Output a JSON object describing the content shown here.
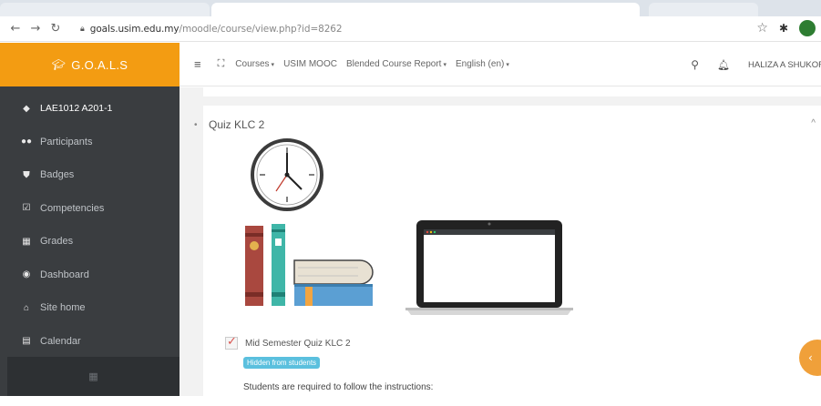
{
  "browser": {
    "url_host": "goals.usim.edu.my",
    "url_path": "/moodle/course/view.php?id=8262",
    "profile_initial": "",
    "colors": {
      "profile": "#2e7d32"
    }
  },
  "brand": {
    "label": "G.O.A.L.S",
    "color": "#f39c12",
    "icon": "graduation-cap-icon"
  },
  "sidebar": {
    "items": [
      {
        "label": "LAE1012 A201-1",
        "icon": "graduation-cap-icon"
      },
      {
        "label": "Participants",
        "icon": "users-icon"
      },
      {
        "label": "Badges",
        "icon": "shield-icon"
      },
      {
        "label": "Competencies",
        "icon": "checkbox-icon"
      },
      {
        "label": "Grades",
        "icon": "table-icon"
      },
      {
        "label": "Dashboard",
        "icon": "dashboard-icon"
      },
      {
        "label": "Site home",
        "icon": "home-icon"
      },
      {
        "label": "Calendar",
        "icon": "calendar-icon"
      }
    ]
  },
  "topnav": {
    "links": [
      {
        "label": "Courses"
      },
      {
        "label": "USIM MOOC"
      },
      {
        "label": "Blended Course Report"
      },
      {
        "label": "English (en)"
      }
    ],
    "user_name": "HALIZA A SHUKOR"
  },
  "section": {
    "title": "Quiz KLC 2",
    "activity": {
      "name": "Mid Semester Quiz KLC 2",
      "badge": "Hidden from students",
      "badge_color": "#5bc0de"
    },
    "description": "Students are required to follow the instructions:"
  },
  "fab": {
    "icon": "chevron-icon",
    "color": "#f0a03a"
  }
}
